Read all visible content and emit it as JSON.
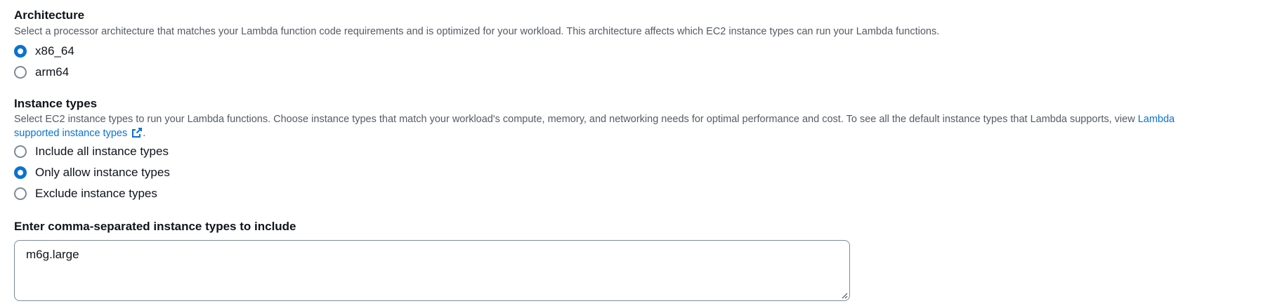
{
  "architecture": {
    "title": "Architecture",
    "description": "Select a processor architecture that matches your Lambda function code requirements and is optimized for your workload. This architecture affects which EC2 instance types can run your Lambda functions.",
    "options": [
      {
        "label": "x86_64",
        "checked": true
      },
      {
        "label": "arm64",
        "checked": false
      }
    ]
  },
  "instance_types": {
    "title": "Instance types",
    "description_text": "Select EC2 instance types to run your Lambda functions. Choose instance types that match your workload's compute, memory, and networking needs for optimal performance and cost. To see all the default instance types that Lambda supports, view",
    "link_text_line1": "Lambda",
    "link_text_line2": "supported instance types",
    "link_icon": "external-link-icon",
    "trailing_period": ".",
    "options": [
      {
        "label": "Include all instance types",
        "checked": false
      },
      {
        "label": "Only allow instance types",
        "checked": true
      },
      {
        "label": "Exclude instance types",
        "checked": false
      }
    ]
  },
  "include_field": {
    "label": "Enter comma-separated instance types to include",
    "value": "m6g.large"
  },
  "colors": {
    "accent": "#0972d3",
    "text": "#0f141a",
    "secondary_text": "#545b64",
    "border": "#7d8998"
  }
}
